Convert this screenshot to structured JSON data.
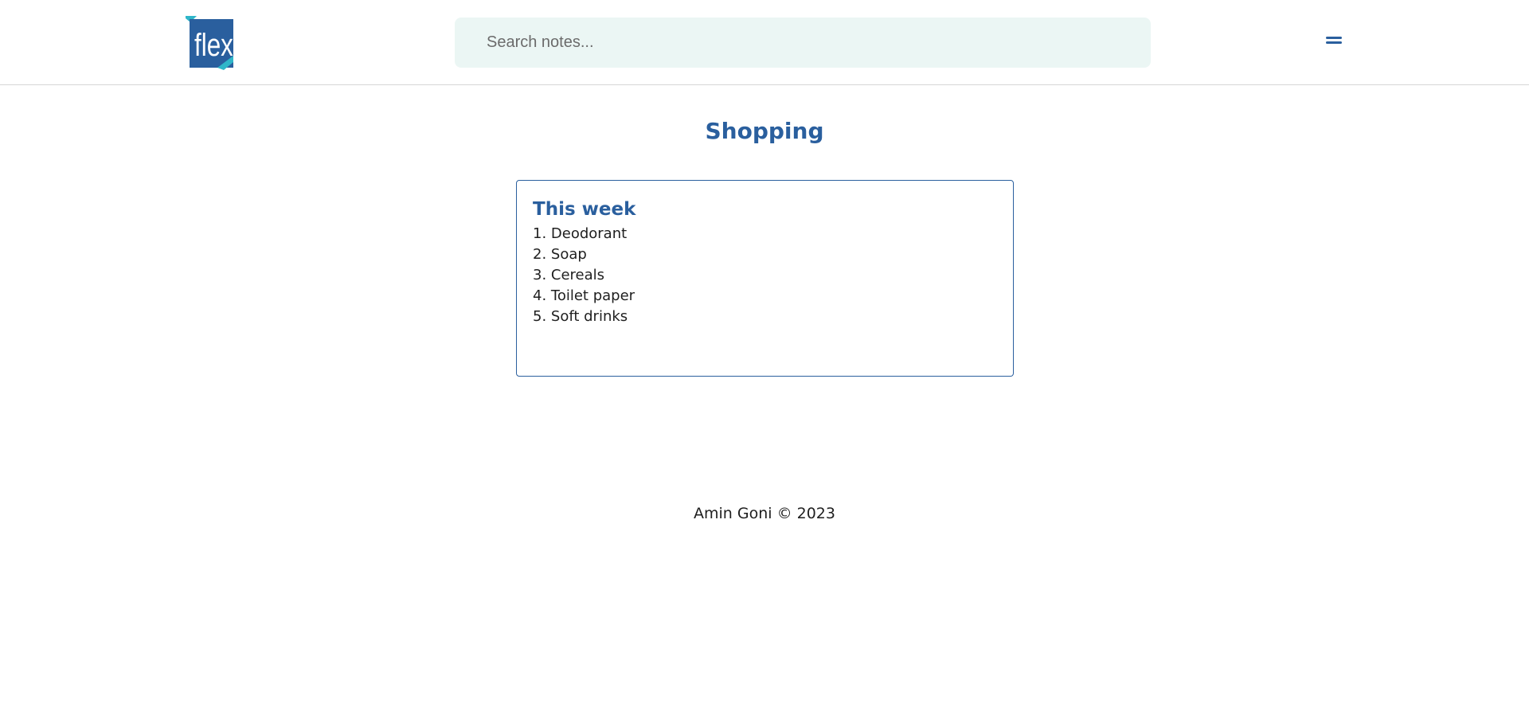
{
  "header": {
    "logo_text": "flexnote",
    "search": {
      "placeholder": "Search notes...",
      "value": ""
    },
    "menu_icon": "hamburger-menu-icon"
  },
  "main": {
    "title": "Shopping",
    "note": {
      "title": "This week",
      "items": [
        "1. Deodorant",
        "2. Soap",
        "3. Cereals",
        "4. Toilet paper",
        "5. Soft drinks"
      ]
    }
  },
  "footer": {
    "text": "Amin Goni © 2023"
  },
  "colors": {
    "brand": "#2a5f9e",
    "accent": "#2fb6c9",
    "search_bg": "#ebf6f4"
  }
}
